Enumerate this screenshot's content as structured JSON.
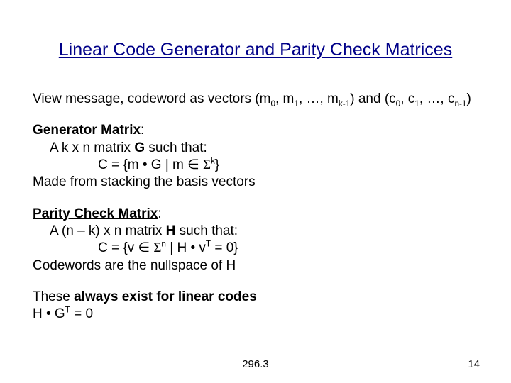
{
  "title": "Linear Code Generator and Parity Check Matrices",
  "intro": {
    "prefix": "View message, codeword as vectors (m",
    "s0": "0",
    "mid1": ", m",
    "s1": "1",
    "mid2": ", …, m",
    "sk": "k-1",
    "mid3": ") and (c",
    "c0": "0",
    "mid4": ", c",
    "c1": "1",
    "mid5": ", …, c",
    "cn": "n-1",
    "suffix": ")"
  },
  "gen": {
    "heading": "Generator Matrix",
    "colon": ":",
    "l1a": "A k x n matrix ",
    "l1b": "G",
    "l1c": " such that:",
    "l2a": "C = {m • G | m ∈ ",
    "sigma": "Σ",
    "l2exp": "k",
    "l2b": "}",
    "l3": "Made from stacking the basis vectors"
  },
  "par": {
    "heading": "Parity Check Matrix",
    "colon": ":",
    "l1a": "A (n – k) x n matrix ",
    "l1b": "H",
    "l1c": " such that:",
    "l2a": "C = {v ∈ ",
    "sigma": "Σ",
    "l2exp": "n",
    "l2b": " | H • v",
    "l2sup": "T",
    "l2c": " = 0}",
    "l3": "Codewords are the nullspace of H"
  },
  "last": {
    "l1a": "These ",
    "l1b": "always exist for linear codes",
    "l2a": "H • G",
    "l2sup": "T",
    "l2b": " = 0"
  },
  "footer": {
    "center": "296.3",
    "right": "14"
  }
}
